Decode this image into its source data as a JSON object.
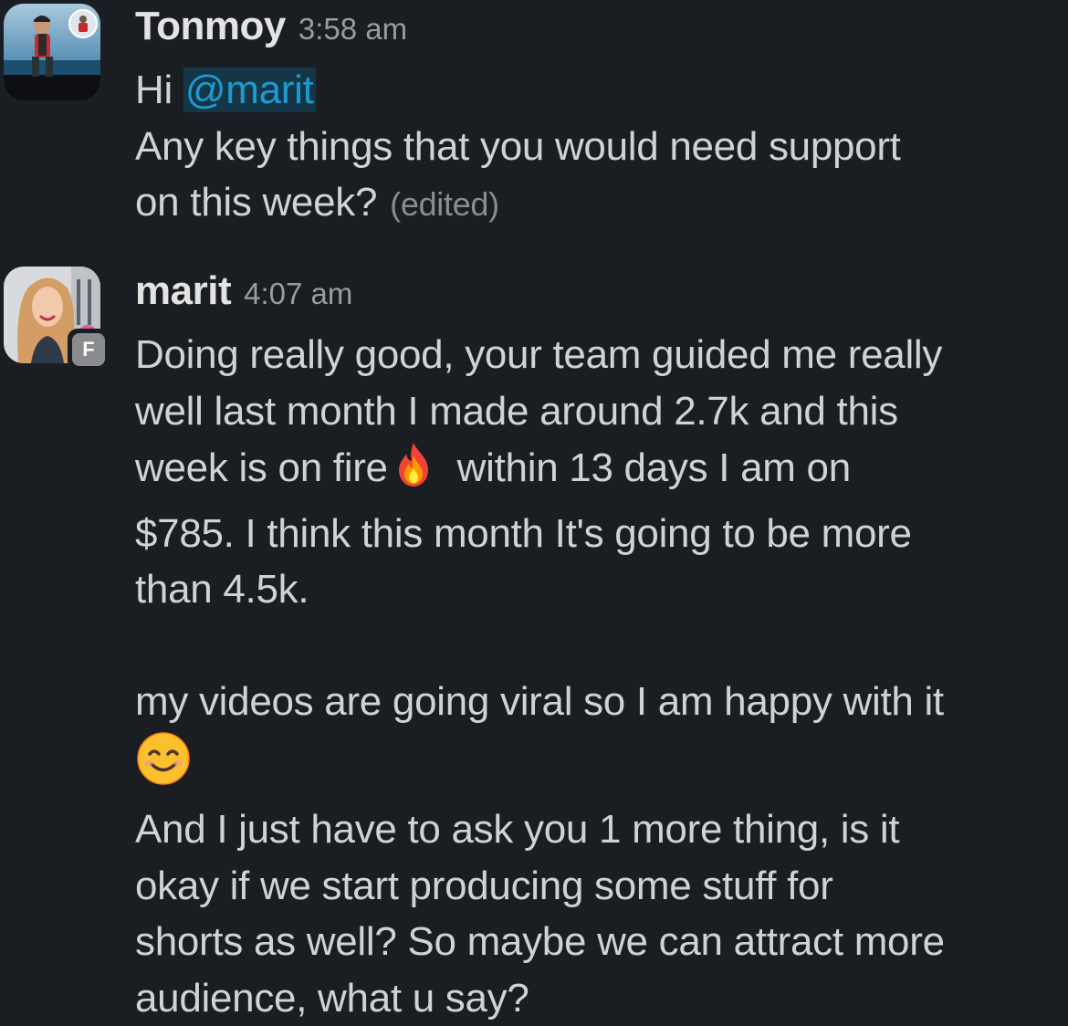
{
  "messages": [
    {
      "author": "Tonmoy",
      "time": "3:58 am",
      "greeting": "Hi",
      "mention": "@marit",
      "lines": [
        "Any key things that you would need support",
        "on this week?"
      ],
      "edited_label": "(edited)"
    },
    {
      "author": "marit",
      "time": "4:07 am",
      "badge": "F",
      "lines": [
        "Doing really good, your team guided me really",
        "well last month I made around 2.7k and this",
        "week is on fire",
        "within 13 days I am on",
        "$785. I think this month It's going to be more",
        "than 4.5k.",
        "my videos are going viral so I am happy with it",
        "And I just have to ask you 1 more thing, is it",
        "okay if we start producing some stuff for",
        "shorts as well? So maybe we can attract more",
        "audience, what u say?"
      ]
    }
  ],
  "icons": {
    "fire": "fire-emoji",
    "smile": "smiling-face-emoji"
  },
  "colors": {
    "background": "#1a1d21",
    "text": "#d1d2d3",
    "mention": "#1d9bd1",
    "mention_bg": "#153647",
    "muted": "#9a9b9c"
  }
}
